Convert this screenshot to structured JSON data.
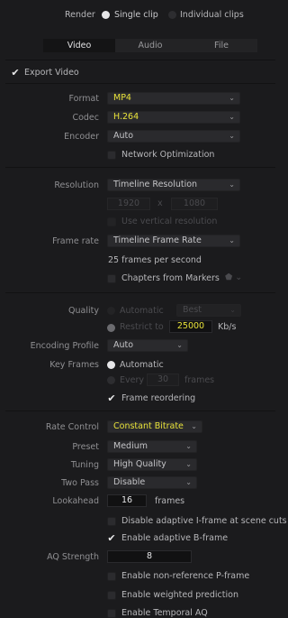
{
  "header": {
    "render_label": "Render",
    "single_clip": "Single clip",
    "individual_clips": "Individual clips"
  },
  "tabs": [
    "Video",
    "Audio",
    "File"
  ],
  "export_video": "Export Video",
  "format": {
    "label": "Format",
    "value": "MP4"
  },
  "codec": {
    "label": "Codec",
    "value": "H.264"
  },
  "encoder": {
    "label": "Encoder",
    "value": "Auto"
  },
  "network_optimization": "Network Optimization",
  "resolution": {
    "label": "Resolution",
    "value": "Timeline Resolution",
    "width": "1920",
    "x": "x",
    "height": "1080",
    "vertical": "Use vertical resolution"
  },
  "frame_rate": {
    "label": "Frame rate",
    "value": "Timeline Frame Rate",
    "fps_text": "25 frames per second"
  },
  "chapters": "Chapters from Markers",
  "quality": {
    "label": "Quality",
    "automatic": "Automatic",
    "best": "Best",
    "restrict": "Restrict to",
    "kbps_value": "25000",
    "kbps_unit": "Kb/s"
  },
  "encoding_profile": {
    "label": "Encoding Profile",
    "value": "Auto"
  },
  "key_frames": {
    "label": "Key Frames",
    "automatic": "Automatic",
    "every": "Every",
    "every_value": "30",
    "frames": "frames"
  },
  "frame_reordering": "Frame reordering",
  "rate_control": {
    "label": "Rate Control",
    "value": "Constant Bitrate"
  },
  "preset": {
    "label": "Preset",
    "value": "Medium"
  },
  "tuning": {
    "label": "Tuning",
    "value": "High Quality"
  },
  "two_pass": {
    "label": "Two Pass",
    "value": "Disable"
  },
  "lookahead": {
    "label": "Lookahead",
    "value": "16",
    "unit": "frames"
  },
  "disable_adaptive_i": "Disable adaptive I-frame at scene cuts",
  "enable_adaptive_b": "Enable adaptive B-frame",
  "aq_strength": {
    "label": "AQ Strength",
    "value": "8"
  },
  "non_reference_p": "Enable non-reference P-frame",
  "weighted_prediction": "Enable weighted prediction",
  "temporal_aq": "Enable Temporal AQ",
  "colors": {
    "background": "#1b1b1d",
    "highlight_yellow": "#e8e23a",
    "text": "#b7b7ba"
  }
}
